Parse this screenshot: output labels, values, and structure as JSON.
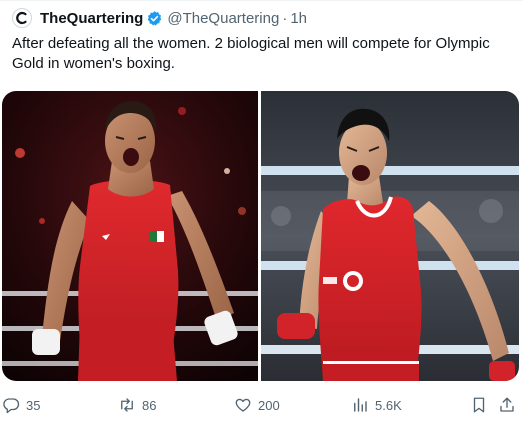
{
  "tweet": {
    "display_name": "TheQuartering",
    "handle": "@TheQuartering",
    "separator": "·",
    "time": "1h",
    "text": "After defeating all the women. 2 biological men will compete for Olympic Gold in women's boxing.",
    "verified": true
  },
  "actions": {
    "replies": "35",
    "reposts": "86",
    "likes": "200",
    "views": "5.6K"
  },
  "colors": {
    "verified_blue": "#1d9bf0",
    "text_secondary": "#536471",
    "left_photo_bg": "#1a0a0c",
    "right_photo_bg": "#3a3f48",
    "jersey_red": "#d6262b"
  },
  "icons": [
    "avatar",
    "verified-badge-icon",
    "reply-icon",
    "repost-icon",
    "like-icon",
    "views-icon",
    "bookmark-icon",
    "share-icon"
  ]
}
